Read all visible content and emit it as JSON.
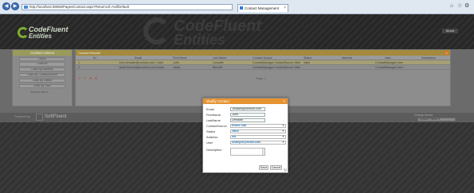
{
  "browser": {
    "url": "http://localhost:38655/Pages/Contact.aspx?ReturnUrl=%2fDefault",
    "tab_title": "Contact Management",
    "tab_close": "×",
    "back": "◀",
    "forward": "▶",
    "home_icon": "⌂",
    "star_icon": "☆",
    "gear_icon": "⚙"
  },
  "header": {
    "logo_line1": "CodeFluent",
    "logo_line2": "Entities",
    "watermark_line1": "CodeFluent",
    "watermark_line2": "Entities",
    "about_label": "About"
  },
  "sidebar": {
    "title": "Contact Actions",
    "buttons": [
      "Users",
      "Load All",
      "Load By Address",
      "Load By ContactSource",
      "Load By Status",
      "Load By User"
    ],
    "search_label": "Search Items"
  },
  "grid": {
    "title": "Contact Results",
    "close": "×",
    "columns": [
      "Id ↑",
      "Email",
      "First Name",
      "Last Name",
      "Contact Source",
      "Status",
      "Address",
      "User",
      "Description"
    ],
    "rows": [
      {
        "id": "1",
        "email": "John.lemadin@contoso.com / John",
        "first": "John",
        "last": "Lemadin",
        "source": "ContactManager.ContactSource.Valid",
        "status": "Valid",
        "address": "",
        "user": "ContactManager.User",
        "desc": ""
      },
      {
        "id": "2",
        "email": "Javier.Bennett@contoso.com/Javier",
        "first": "Javier",
        "last": "Bennett",
        "source": "ContactManager.ContactSource.Valid",
        "status": "",
        "address": "",
        "user": "ContactManager.User",
        "desc": ""
      }
    ],
    "pager_text": "Page: 1",
    "pager_icons": [
      "⟳",
      "✎",
      "✖",
      "⊞"
    ]
  },
  "footer": {
    "left_text": "Powered by",
    "brand": "SoftFluent",
    "right_text": "Change theme:",
    "theme_value": "Default Theme ▾"
  },
  "modal": {
    "title": "Modify Contact",
    "close": "×",
    "fields": {
      "email": {
        "label": "Email",
        "value": "Jlmadin@contoso.com"
      },
      "first_name": {
        "label": "FirstName",
        "value": "John"
      },
      "last_name": {
        "label": "LastName",
        "value": "Lemadin"
      },
      "contact_source": {
        "label": "ContactSource",
        "value": "Direct Call"
      },
      "status": {
        "label": "Status",
        "value": "Valid"
      },
      "address": {
        "label": "Address",
        "value": "n/a"
      },
      "user": {
        "label": "User",
        "value": "example@email.com"
      },
      "description": {
        "label": "Description",
        "value": ""
      }
    },
    "save_label": "Save",
    "cancel_label": "Cancel"
  },
  "colors": {
    "accent_orange": "#e69330",
    "link_blue": "#2a79b5",
    "logo_green": "#7fae2c"
  }
}
